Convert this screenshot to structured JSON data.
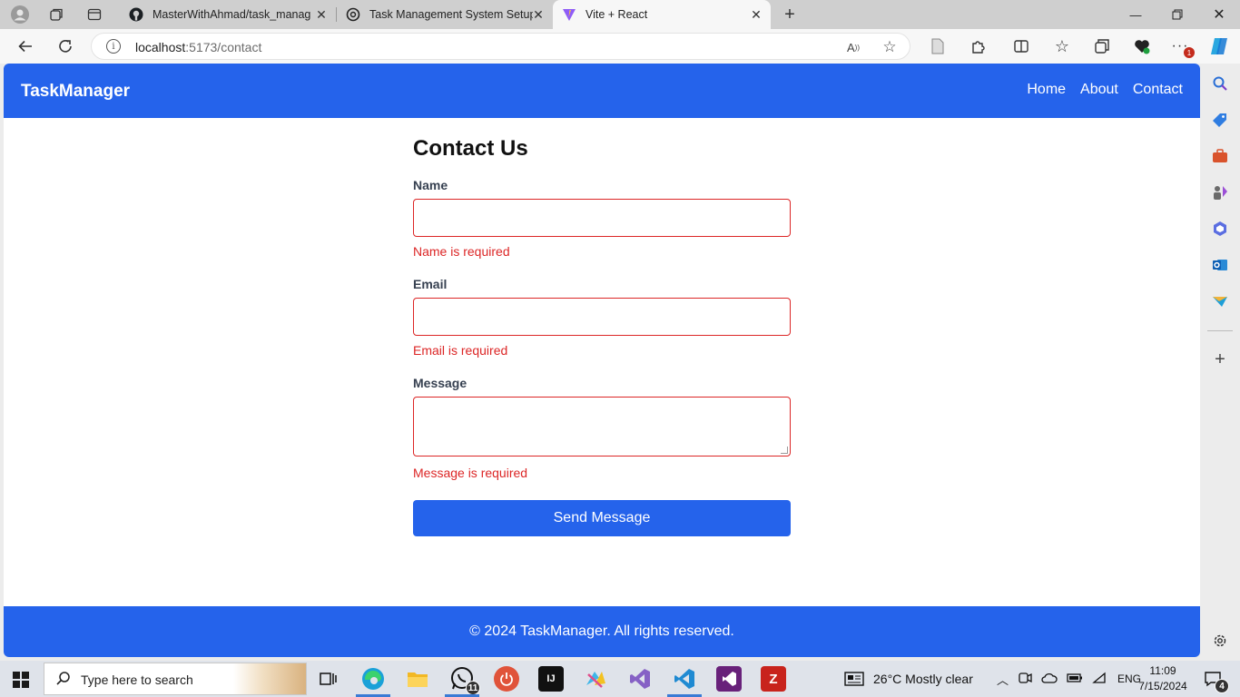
{
  "browser": {
    "tabs": [
      {
        "title": "MasterWithAhmad/task_manage",
        "icon": "github-icon"
      },
      {
        "title": "Task Management System Setup",
        "icon": "chatgpt-icon"
      },
      {
        "title": "Vite + React",
        "icon": "vite-icon",
        "active": true
      }
    ],
    "url_host": "localhost",
    "url_path": ":5173/contact",
    "notification_count": "1"
  },
  "site": {
    "brand": "TaskManager",
    "nav": [
      "Home",
      "About",
      "Contact"
    ],
    "primary_color": "#2563eb",
    "error_color": "#dc2626"
  },
  "contact_form": {
    "title": "Contact Us",
    "name_label": "Name",
    "name_value": "",
    "name_error": "Name is required",
    "email_label": "Email",
    "email_value": "",
    "email_error": "Email is required",
    "message_label": "Message",
    "message_value": "",
    "message_error": "Message is required",
    "submit_label": "Send Message"
  },
  "footer": {
    "text": "© 2024 TaskManager. All rights reserved."
  },
  "taskbar": {
    "search_placeholder": "Type here to search",
    "whatsapp_badge": "11",
    "weather": "26°C  Mostly clear",
    "language": "ENG",
    "time": "11:09",
    "date": "7/15/2024",
    "notification_badge": "4"
  }
}
